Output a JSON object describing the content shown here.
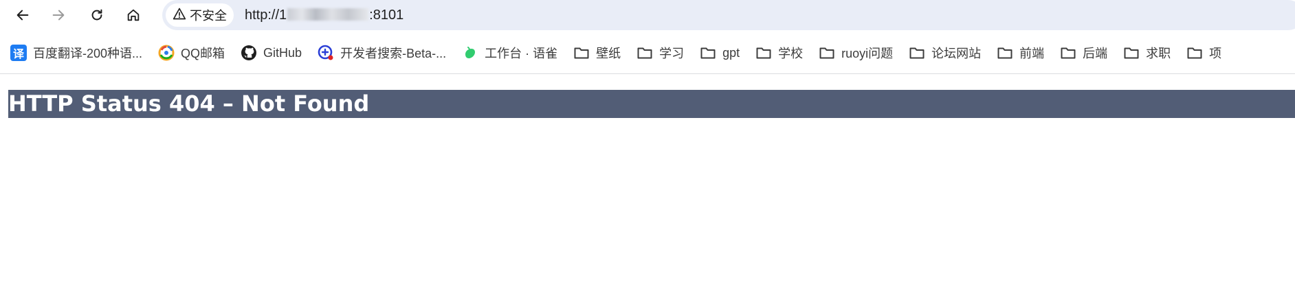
{
  "toolbar": {
    "back_icon": "arrow-left-icon",
    "forward_icon": "arrow-right-icon",
    "reload_icon": "reload-icon",
    "home_icon": "home-icon"
  },
  "omnibox": {
    "security_label": "不安全",
    "security_icon": "warning-triangle-icon",
    "url_prefix": "http://1",
    "url_suffix": ":8101"
  },
  "bookmarks": [
    {
      "label": "百度翻译-200种语...",
      "icon": "translate-icon",
      "icon_text": "译"
    },
    {
      "label": "QQ邮箱",
      "icon": "qq-mail-icon"
    },
    {
      "label": "GitHub",
      "icon": "github-icon"
    },
    {
      "label": "开发者搜索-Beta-...",
      "icon": "dev-search-icon"
    },
    {
      "label": "工作台 · 语雀",
      "icon": "yuque-icon"
    },
    {
      "label": "壁纸",
      "icon": "folder-icon"
    },
    {
      "label": "学习",
      "icon": "folder-icon"
    },
    {
      "label": "gpt",
      "icon": "folder-icon"
    },
    {
      "label": "学校",
      "icon": "folder-icon"
    },
    {
      "label": "ruoyi问题",
      "icon": "folder-icon"
    },
    {
      "label": "论坛网站",
      "icon": "folder-icon"
    },
    {
      "label": "前端",
      "icon": "folder-icon"
    },
    {
      "label": "后端",
      "icon": "folder-icon"
    },
    {
      "label": "求职",
      "icon": "folder-icon"
    },
    {
      "label": "项",
      "icon": "folder-icon"
    }
  ],
  "page": {
    "heading": "HTTP Status 404 – Not Found"
  },
  "colors": {
    "heading_bg": "#525d76",
    "heading_text": "#ffffff",
    "omnibox_bg": "#e9edf7"
  }
}
